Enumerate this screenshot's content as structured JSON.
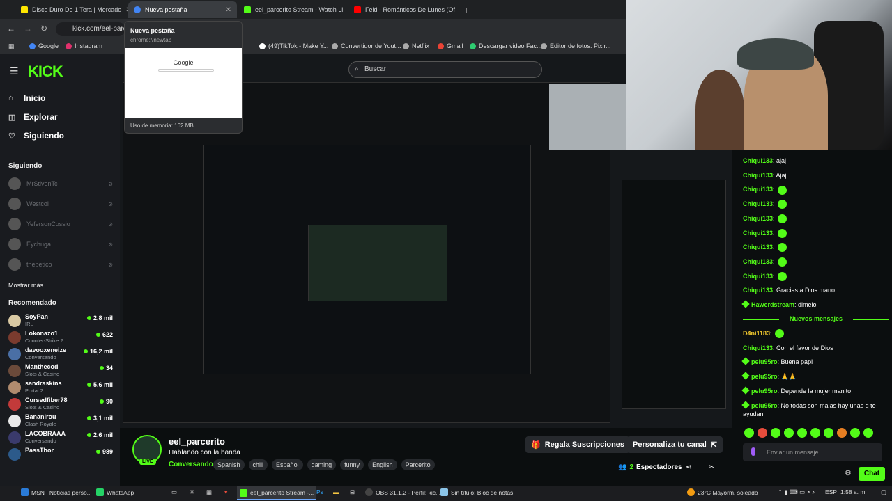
{
  "browser": {
    "tabs": [
      {
        "label": "Disco Duro De 1 Tera | Mercado",
        "color": "#ffe600"
      },
      {
        "label": "Nueva pestaña",
        "color": "#4285f4"
      },
      {
        "label": "eel_parcerito Stream - Watch Li",
        "color": "#53fc18"
      },
      {
        "label": "Feid - Románticos De Lunes (Of",
        "color": "#ff0000"
      }
    ],
    "url": "kick.com/eel-parc",
    "bookmarks": [
      "Google",
      "Instagram",
      "(49)TikTok - Make Y...",
      "Convertidor de Yout...",
      "Netflix",
      "Gmail",
      "Descargar video Fac...",
      "Editor de fotos: Pixlr..."
    ],
    "hover_card": {
      "title": "Nueva pestaña",
      "url": "chrome://newtab",
      "preview_logo": "Google",
      "memory": "Uso de memoria: 162 MB"
    }
  },
  "kick": {
    "logo": "KICK",
    "search_placeholder": "Buscar",
    "nav": [
      "Inicio",
      "Explorar",
      "Siguiendo"
    ],
    "following_header": "Siguiendo",
    "following": [
      "MrStivenTc",
      "Westcol",
      "YefersonCossio",
      "Eychuga",
      "thebetico"
    ],
    "show_more": "Mostrar más",
    "recommended_header": "Recomendado",
    "recommended": [
      {
        "name": "SoyPan",
        "category": "IRL",
        "viewers": "2,8 mil",
        "color": "#d9c9a3"
      },
      {
        "name": "Lokonazo1",
        "category": "Counter-Strike 2",
        "viewers": "622",
        "color": "#7a3b2e"
      },
      {
        "name": "davooxeneize",
        "category": "Conversando",
        "viewers": "16,2 mil",
        "color": "#4a6fa5"
      },
      {
        "name": "Manthecod",
        "category": "Slots & Casino",
        "viewers": "34",
        "color": "#6b4a3a"
      },
      {
        "name": "sandraskins",
        "category": "Portal 2",
        "viewers": "5,6 mil",
        "color": "#b08b6e"
      },
      {
        "name": "Cursedfiber78",
        "category": "Slots & Casino",
        "viewers": "90",
        "color": "#c23a3a"
      },
      {
        "name": "Bananirou",
        "category": "Clash Royale",
        "viewers": "3,1 mil",
        "color": "#e8e8e8"
      },
      {
        "name": "LACOBRAAA",
        "category": "Conversando",
        "viewers": "2,6 mil",
        "color": "#3a3a6b"
      },
      {
        "name": "PassThor",
        "category": "",
        "viewers": "989",
        "color": "#2c5a8a"
      }
    ]
  },
  "stream": {
    "channel": "eel_parcerito",
    "title": "Hablando con la banda",
    "category": "Conversando",
    "tags": [
      "Spanish",
      "chill",
      "Español",
      "gaming",
      "funny",
      "English",
      "Parcerito"
    ],
    "live_badge": "LIVE",
    "subs_button": "Regala Suscripciones",
    "customize_button": "Personaliza tu canal",
    "viewers_count": "2",
    "viewers_label": "Espectadores"
  },
  "chat": {
    "messages": [
      {
        "user": "Chiqui133",
        "text": "ajaj",
        "emotes": 0
      },
      {
        "user": "Chiqui133",
        "text": "Ajaj",
        "emotes": 0
      },
      {
        "user": "Chiqui133",
        "text": "",
        "emotes": 1
      },
      {
        "user": "Chiqui133",
        "text": "",
        "emotes": 1
      },
      {
        "user": "Chiqui133",
        "text": "",
        "emotes": 1
      },
      {
        "user": "Chiqui133",
        "text": "",
        "emotes": 1
      },
      {
        "user": "Chiqui133",
        "text": "",
        "emotes": 1
      },
      {
        "user": "Chiqui133",
        "text": "",
        "emotes": 1
      },
      {
        "user": "Chiqui133",
        "text": "",
        "emotes": 1
      },
      {
        "user": "Chiqui133",
        "text": "Gracias a Dios mano",
        "emotes": 0
      },
      {
        "user": "Hawerdstream",
        "text": "dimelo",
        "emotes": 0,
        "badge": true
      }
    ],
    "new_messages": "Nuevos mensajes",
    "messages_after": [
      {
        "user": "D4ni1183",
        "text": "",
        "emotes": 1,
        "yellow": true
      },
      {
        "user": "Chiqui133",
        "text": "Con el favor de Dios",
        "emotes": 0
      },
      {
        "user": "pelu95ro",
        "text": "Buena papi",
        "emotes": 0,
        "badge": true
      },
      {
        "user": "pelu95ro",
        "text": "🙏🙏",
        "emotes": 0,
        "badge": true
      },
      {
        "user": "pelu95ro",
        "text": "Depende la mujer manito",
        "emotes": 0,
        "badge": true
      },
      {
        "user": "pelu95ro",
        "text": "No todas son malas hay unas q te ayudan",
        "emotes": 0,
        "badge": true
      }
    ],
    "input_placeholder": "Enviar un mensaje",
    "send_label": "Chat"
  },
  "taskbar": {
    "items": [
      "MSN | Noticias perso...",
      "WhatsApp",
      "eel_parcerito Stream -...",
      "OBS 31.1.2 - Perfil: kic...",
      "Sin título: Bloc de notas"
    ],
    "weather": "23°C  Mayorm. soleado",
    "lang": "ESP",
    "time": "1:58 a. m."
  },
  "colors": {
    "accent": "#53fc18",
    "bg": "#0b0e0f",
    "sidebar": "#191b1f"
  }
}
